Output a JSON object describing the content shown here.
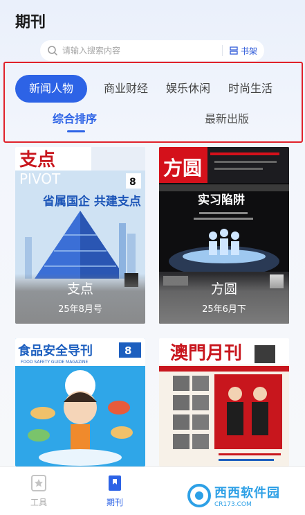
{
  "header": {
    "title": "期刊"
  },
  "search": {
    "placeholder": "请输入搜索内容",
    "shelf_label": "书架"
  },
  "categories": [
    {
      "label": "新闻人物",
      "active": true
    },
    {
      "label": "商业财经",
      "active": false
    },
    {
      "label": "娱乐休闲",
      "active": false
    },
    {
      "label": "时尚生活",
      "active": false
    }
  ],
  "sort_tabs": [
    {
      "label": "综合排序",
      "active": true
    },
    {
      "label": "最新出版",
      "active": false
    }
  ],
  "magazines": [
    {
      "name": "支点",
      "issue": "25年8月号",
      "cover": {
        "masthead": "支点",
        "sub": "PIVOT",
        "headline": "省属国企 共建支点",
        "badge": "8"
      }
    },
    {
      "name": "方圆",
      "issue": "25年6月下",
      "cover": {
        "masthead": "方圆",
        "headline": "实习陷阱"
      }
    },
    {
      "name": "食品安全导刊",
      "issue": "",
      "cover": {
        "masthead": "食品安全导刊",
        "sub": "FOOD SAFETY GUIDE MAGAZINE",
        "badge": "8"
      }
    },
    {
      "name": "澳门月刊",
      "issue": "",
      "cover": {
        "masthead": "澳門月刊"
      }
    }
  ],
  "bottom_nav": [
    {
      "label": "工具",
      "icon": "star-bookmark-icon",
      "active": false
    },
    {
      "label": "期刊",
      "icon": "magazine-bookmark-icon",
      "active": true
    }
  ],
  "watermark": {
    "text": "西西软件园",
    "sub": "CR173.COM"
  },
  "colors": {
    "accent": "#2d63e6",
    "highlight_border": "#e0202a"
  }
}
